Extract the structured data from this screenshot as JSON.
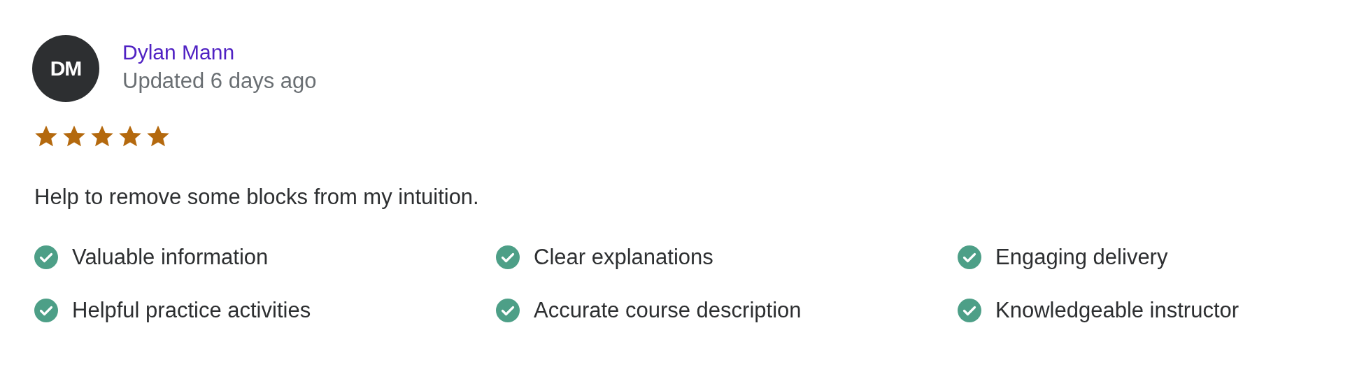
{
  "review": {
    "avatar_initials": "DM",
    "author": "Dylan Mann",
    "updated": "Updated 6 days ago",
    "stars": 5,
    "text": "Help to remove some blocks from my intuition.",
    "highlights": [
      {
        "label": "Valuable information",
        "checked": true
      },
      {
        "label": "Clear explanations",
        "checked": true
      },
      {
        "label": "Engaging delivery",
        "checked": true
      },
      {
        "label": "Helpful practice activities",
        "checked": true
      },
      {
        "label": "Accurate course description",
        "checked": true
      },
      {
        "label": "Knowledgeable instructor",
        "checked": true
      }
    ]
  }
}
